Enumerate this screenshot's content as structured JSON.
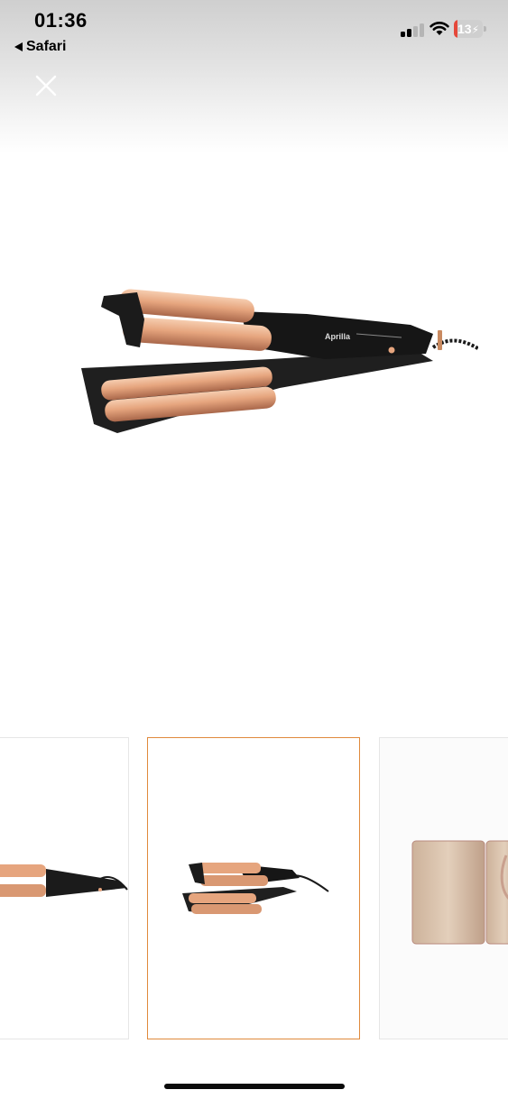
{
  "status_bar": {
    "time": "01:36",
    "back_app": "Safari",
    "battery_level": "13",
    "battery_fraction": 0.13,
    "signal_bars_active": 2,
    "signal_bars_total": 4,
    "charging": true,
    "battery_color": "#e5483a"
  },
  "viewer": {
    "close_icon": "close-icon",
    "main_image": {
      "brand_text": "Aprilla",
      "subject": "triple barrel hair waver"
    },
    "thumbnails": [
      {
        "name": "product-side-view",
        "selected": false
      },
      {
        "name": "product-full-view",
        "selected": true
      },
      {
        "name": "hair-result-photo",
        "selected": false
      }
    ],
    "accent_color": "#e08a3c",
    "barrel_color": "#e6a57e"
  }
}
